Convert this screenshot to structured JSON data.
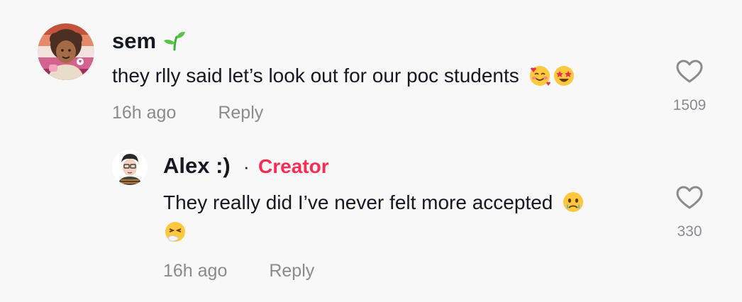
{
  "comments": [
    {
      "username": "sem",
      "text": "they rlly said let’s look out for our poc students",
      "time": "16h ago",
      "reply_label": "Reply",
      "likes": "1509",
      "username_emoji": "seedling-icon",
      "text_emojis": [
        "smiling-face-with-hearts-icon",
        "star-struck-icon"
      ]
    },
    {
      "username": "Alex :)",
      "separator": "·",
      "badge": "Creator",
      "text": "They really did I’ve never felt more accepted",
      "time": "16h ago",
      "reply_label": "Reply",
      "likes": "330",
      "text_emojis": [
        "face-holding-back-tears-icon",
        "sneezing-face-icon"
      ]
    }
  ],
  "colors": {
    "background": "#f8f8f8",
    "creator": "#fe2c55",
    "text": "#161823",
    "meta": "#8a8b91"
  }
}
